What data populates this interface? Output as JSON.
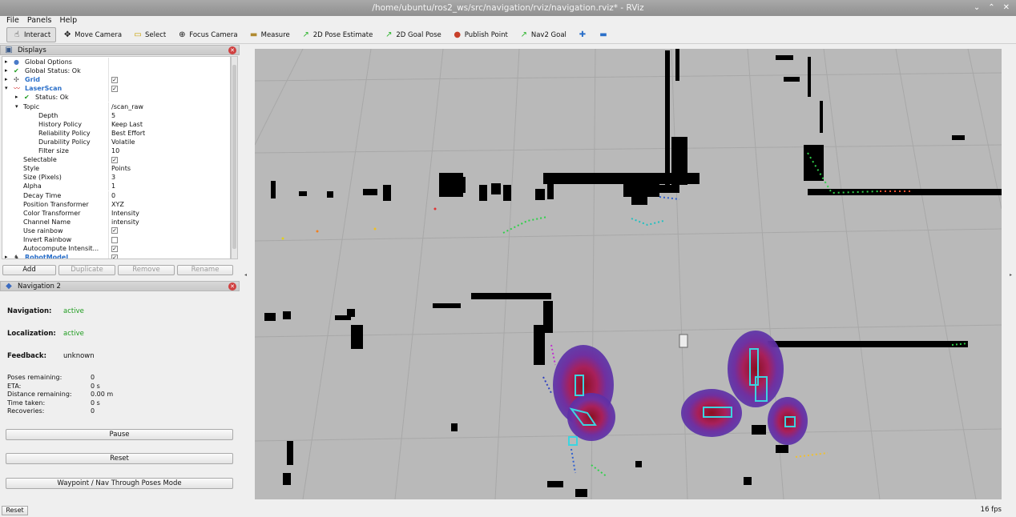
{
  "window": {
    "title": "/home/ubuntu/ros2_ws/src/navigation/rviz/navigation.rviz* - RViz"
  },
  "menu": [
    "File",
    "Panels",
    "Help"
  ],
  "toolbar": [
    {
      "label": "Interact",
      "icon": "cursor-icon"
    },
    {
      "label": "Move Camera",
      "icon": "move-icon"
    },
    {
      "label": "Select",
      "icon": "select-icon"
    },
    {
      "label": "Focus Camera",
      "icon": "focus-icon"
    },
    {
      "label": "Measure",
      "icon": "ruler-icon"
    },
    {
      "label": "2D Pose Estimate",
      "icon": "green-arrow-icon"
    },
    {
      "label": "2D Goal Pose",
      "icon": "green-arrow-icon"
    },
    {
      "label": "Publish Point",
      "icon": "pin-icon"
    },
    {
      "label": "Nav2 Goal",
      "icon": "green-arrow-icon"
    }
  ],
  "displays": {
    "title": "Displays",
    "rows": [
      {
        "label": "Global Options",
        "value": "",
        "indent": 0,
        "expander": "▸",
        "icon": "globe",
        "check": null
      },
      {
        "label": "Global Status: Ok",
        "value": "",
        "indent": 0,
        "expander": "▸",
        "icon": "ok",
        "check": null
      },
      {
        "label": "Grid",
        "value": "",
        "indent": 0,
        "expander": "▸",
        "icon": "grid",
        "check": true,
        "blue": true
      },
      {
        "label": "LaserScan",
        "value": "",
        "indent": 0,
        "expander": "▾",
        "icon": "laser",
        "check": true,
        "blue": true
      },
      {
        "label": "Status: Ok",
        "value": "",
        "indent": 1,
        "expander": "▸",
        "icon": "ok",
        "check": null
      },
      {
        "label": "Topic",
        "value": "/scan_raw",
        "indent": 1,
        "expander": "▾",
        "icon": "",
        "check": null
      },
      {
        "label": "Depth",
        "value": "5",
        "indent": 2,
        "expander": "",
        "icon": "",
        "check": null
      },
      {
        "label": "History Policy",
        "value": "Keep Last",
        "indent": 2,
        "expander": "",
        "icon": "",
        "check": null
      },
      {
        "label": "Reliability Policy",
        "value": "Best Effort",
        "indent": 2,
        "expander": "",
        "icon": "",
        "check": null
      },
      {
        "label": "Durability Policy",
        "value": "Volatile",
        "indent": 2,
        "expander": "",
        "icon": "",
        "check": null
      },
      {
        "label": "Filter size",
        "value": "10",
        "indent": 2,
        "expander": "",
        "icon": "",
        "check": null
      },
      {
        "label": "Selectable",
        "value": "",
        "indent": 1,
        "expander": "",
        "icon": "",
        "check": true
      },
      {
        "label": "Style",
        "value": "Points",
        "indent": 1,
        "expander": "",
        "icon": "",
        "check": null
      },
      {
        "label": "Size (Pixels)",
        "value": "3",
        "indent": 1,
        "expander": "",
        "icon": "",
        "check": null
      },
      {
        "label": "Alpha",
        "value": "1",
        "indent": 1,
        "expander": "",
        "icon": "",
        "check": null
      },
      {
        "label": "Decay Time",
        "value": "0",
        "indent": 1,
        "expander": "",
        "icon": "",
        "check": null
      },
      {
        "label": "Position Transformer",
        "value": "XYZ",
        "indent": 1,
        "expander": "",
        "icon": "",
        "check": null
      },
      {
        "label": "Color Transformer",
        "value": "Intensity",
        "indent": 1,
        "expander": "",
        "icon": "",
        "check": null
      },
      {
        "label": "Channel Name",
        "value": "intensity",
        "indent": 1,
        "expander": "",
        "icon": "",
        "check": null
      },
      {
        "label": "Use rainbow",
        "value": "",
        "indent": 1,
        "expander": "",
        "icon": "",
        "check": true
      },
      {
        "label": "Invert Rainbow",
        "value": "",
        "indent": 1,
        "expander": "",
        "icon": "",
        "check": false
      },
      {
        "label": "Autocompute Intensit...",
        "value": "",
        "indent": 1,
        "expander": "",
        "icon": "",
        "check": true
      },
      {
        "label": "RobotModel",
        "value": "",
        "indent": 0,
        "expander": "▸",
        "icon": "robot",
        "check": true,
        "blue": true
      }
    ],
    "buttons": {
      "add": "Add",
      "duplicate": "Duplicate",
      "remove": "Remove",
      "rename": "Rename"
    }
  },
  "navigation": {
    "title": "Navigation 2",
    "navigation_label": "Navigation:",
    "navigation_value": "active",
    "localization_label": "Localization:",
    "localization_value": "active",
    "feedback_label": "Feedback:",
    "feedback_value": "unknown",
    "stats": [
      {
        "label": "Poses remaining:",
        "value": "0"
      },
      {
        "label": "ETA:",
        "value": "0 s"
      },
      {
        "label": "Distance remaining:",
        "value": "0.00 m"
      },
      {
        "label": "Time taken:",
        "value": "0 s"
      },
      {
        "label": "Recoveries:",
        "value": "0"
      }
    ],
    "pause": "Pause",
    "reset": "Reset",
    "waypoint": "Waypoint / Nav Through Poses Mode"
  },
  "status": {
    "reset": "Reset",
    "fps": "16 fps"
  },
  "colors": {
    "viewport_bg": "#b9b9b9",
    "map_wall": "#000000",
    "status_ok": "#1e9c1e",
    "link_blue": "#2a6fc9"
  }
}
